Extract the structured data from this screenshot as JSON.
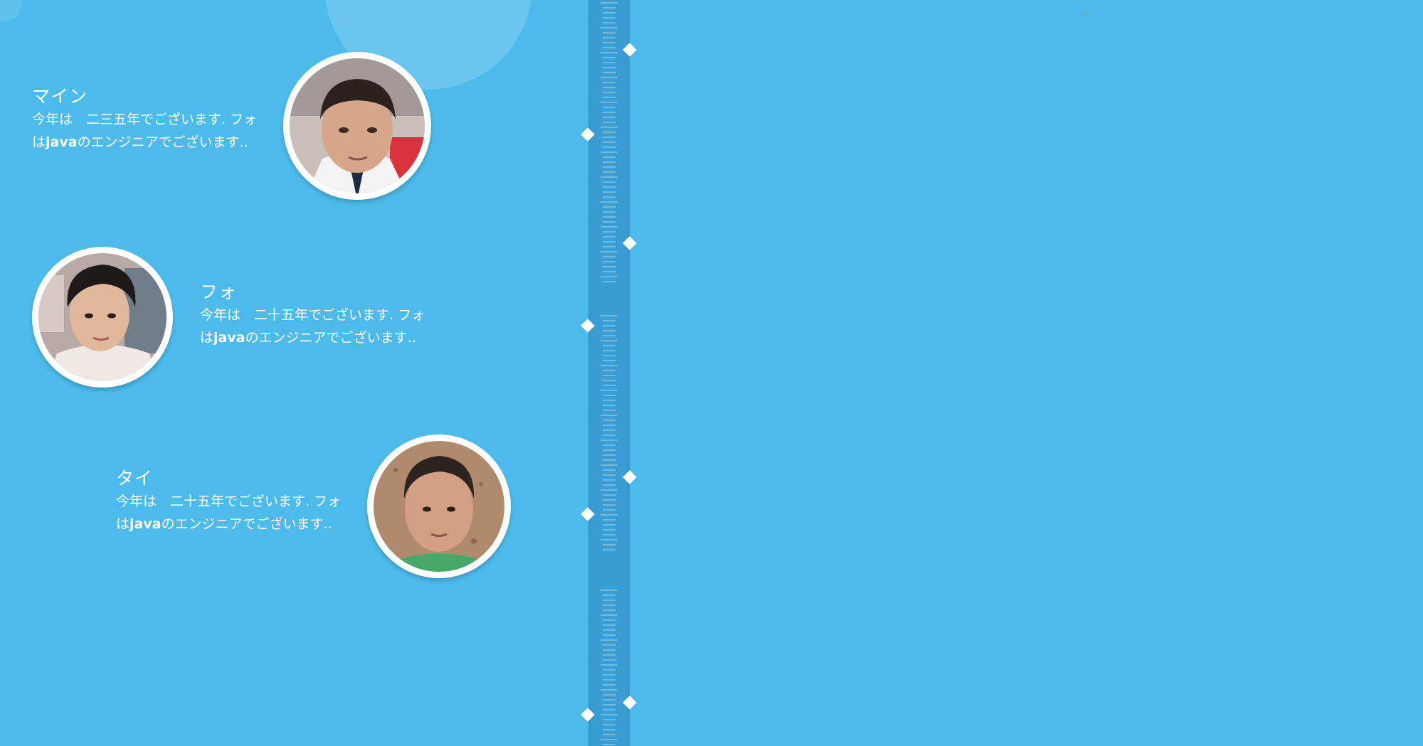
{
  "members": [
    {
      "name": "マイン",
      "desc_line1": "今年は　二三五年でございます. フォ",
      "desc_line2_pre": "は",
      "desc_line2_bold": "java",
      "desc_line2_post": "のエンジニアでございます..",
      "avatar_icon": "person-photo-icon"
    },
    {
      "name": "フォ",
      "desc_line1": "今年は　二十五年でございます. フォ",
      "desc_line2_pre": "は",
      "desc_line2_bold": "java",
      "desc_line2_post": "のエンジニアでございます..",
      "avatar_icon": "person-photo-icon"
    },
    {
      "name": "タイ",
      "desc_line1": "今年は　二十五年でございます. フォ",
      "desc_line2_pre": "は",
      "desc_line2_bold": "java",
      "desc_line2_post": "のエンジニアでございます..",
      "avatar_icon": "person-photo-icon"
    }
  ],
  "colors": {
    "background": "#4cbbeb",
    "timeline": "#3a9ed4",
    "text": "#ffffff"
  }
}
